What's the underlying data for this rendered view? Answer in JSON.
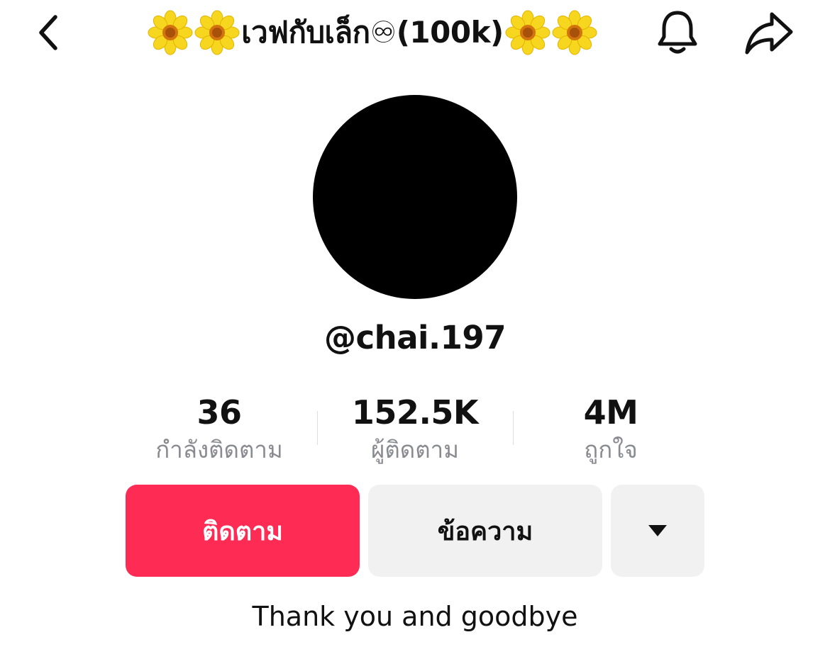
{
  "header": {
    "back_icon": "chevron-left-icon",
    "title_text": "เวฟกับเล็ก♾(100k)",
    "title_decoration_icon": "sunflower-emoji",
    "notification_icon": "bell-icon",
    "share_icon": "share-arrow-icon"
  },
  "profile": {
    "avatar_color": "#000000",
    "username": "@chai.197"
  },
  "stats": [
    {
      "value": "36",
      "label": "กำลังติดตาม"
    },
    {
      "value": "152.5K",
      "label": "ผู้ติดตาม"
    },
    {
      "value": "4M",
      "label": "ถูกใจ"
    }
  ],
  "actions": {
    "follow_label": "ติดตาม",
    "message_label": "ข้อความ",
    "more_icon": "caret-down-icon"
  },
  "bio": "Thank you and goodbye",
  "colors": {
    "accent": "#fe2c55",
    "secondary_button": "#f1f1f2",
    "muted_text": "#8a8b91"
  }
}
